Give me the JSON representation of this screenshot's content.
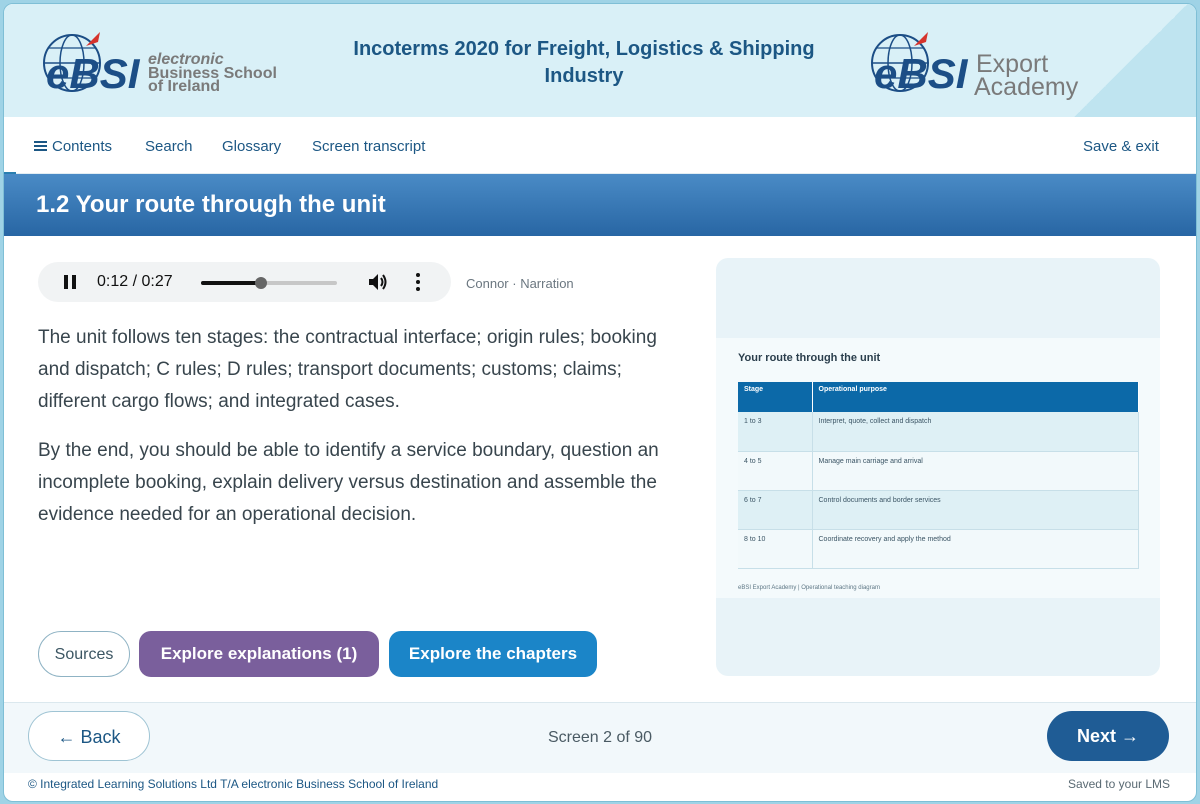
{
  "header": {
    "course_title": "Incoterms 2020 for Freight, Logistics & Shipping Industry",
    "logo_left": {
      "mark": "eBSI",
      "line1": "electronic",
      "line2": "Business School",
      "line3": "of Ireland"
    },
    "logo_right": {
      "mark": "eBSI",
      "line1": "Export",
      "line2": "Academy"
    }
  },
  "nav": {
    "contents": "Contents",
    "search": "Search",
    "glossary": "Glossary",
    "transcript": "Screen transcript",
    "save_exit": "Save & exit"
  },
  "section": {
    "title": "1.2 Your route through the unit"
  },
  "audio": {
    "time": "0:12 / 0:27",
    "progress": 0.44,
    "narration": "Connor · Narration"
  },
  "body": {
    "p1": "The unit follows ten stages: the contractual interface; origin rules; booking and dispatch; C rules; D rules; transport documents; customs; claims; different cargo flows; and integrated cases.",
    "p2": "By the end, you should be able to identify a service boundary, question an incomplete booking, explain delivery versus destination and assemble the evidence needed for an operational decision."
  },
  "buttons": {
    "sources": "Sources",
    "explanations": "Explore explanations (1)",
    "chapters": "Explore the chapters"
  },
  "diagram": {
    "title": "Your route through the unit",
    "headers": [
      "Stage",
      "Operational purpose"
    ],
    "rows": [
      [
        "1 to 3",
        "Interpret, quote, collect and dispatch"
      ],
      [
        "4 to 5",
        "Manage main carriage and arrival"
      ],
      [
        "6 to 7",
        "Control documents and border services"
      ],
      [
        "8 to 10",
        "Coordinate recovery and apply the method"
      ]
    ],
    "footer": "eBSI Export Academy | Operational teaching diagram"
  },
  "footer": {
    "back": "← Back",
    "screen": "Screen 2 of 90",
    "next": "Next →",
    "copyright": "© Integrated Learning Solutions Ltd T/A electronic Business School of Ireland",
    "saved": "Saved to your LMS"
  },
  "colors": {
    "brand_blue": "#1c5784",
    "section_bar": "#2866a4",
    "purple_button": "#7a5f9c",
    "chapters_button": "#1b85c8",
    "logo_grey": "#7a7a7a"
  }
}
